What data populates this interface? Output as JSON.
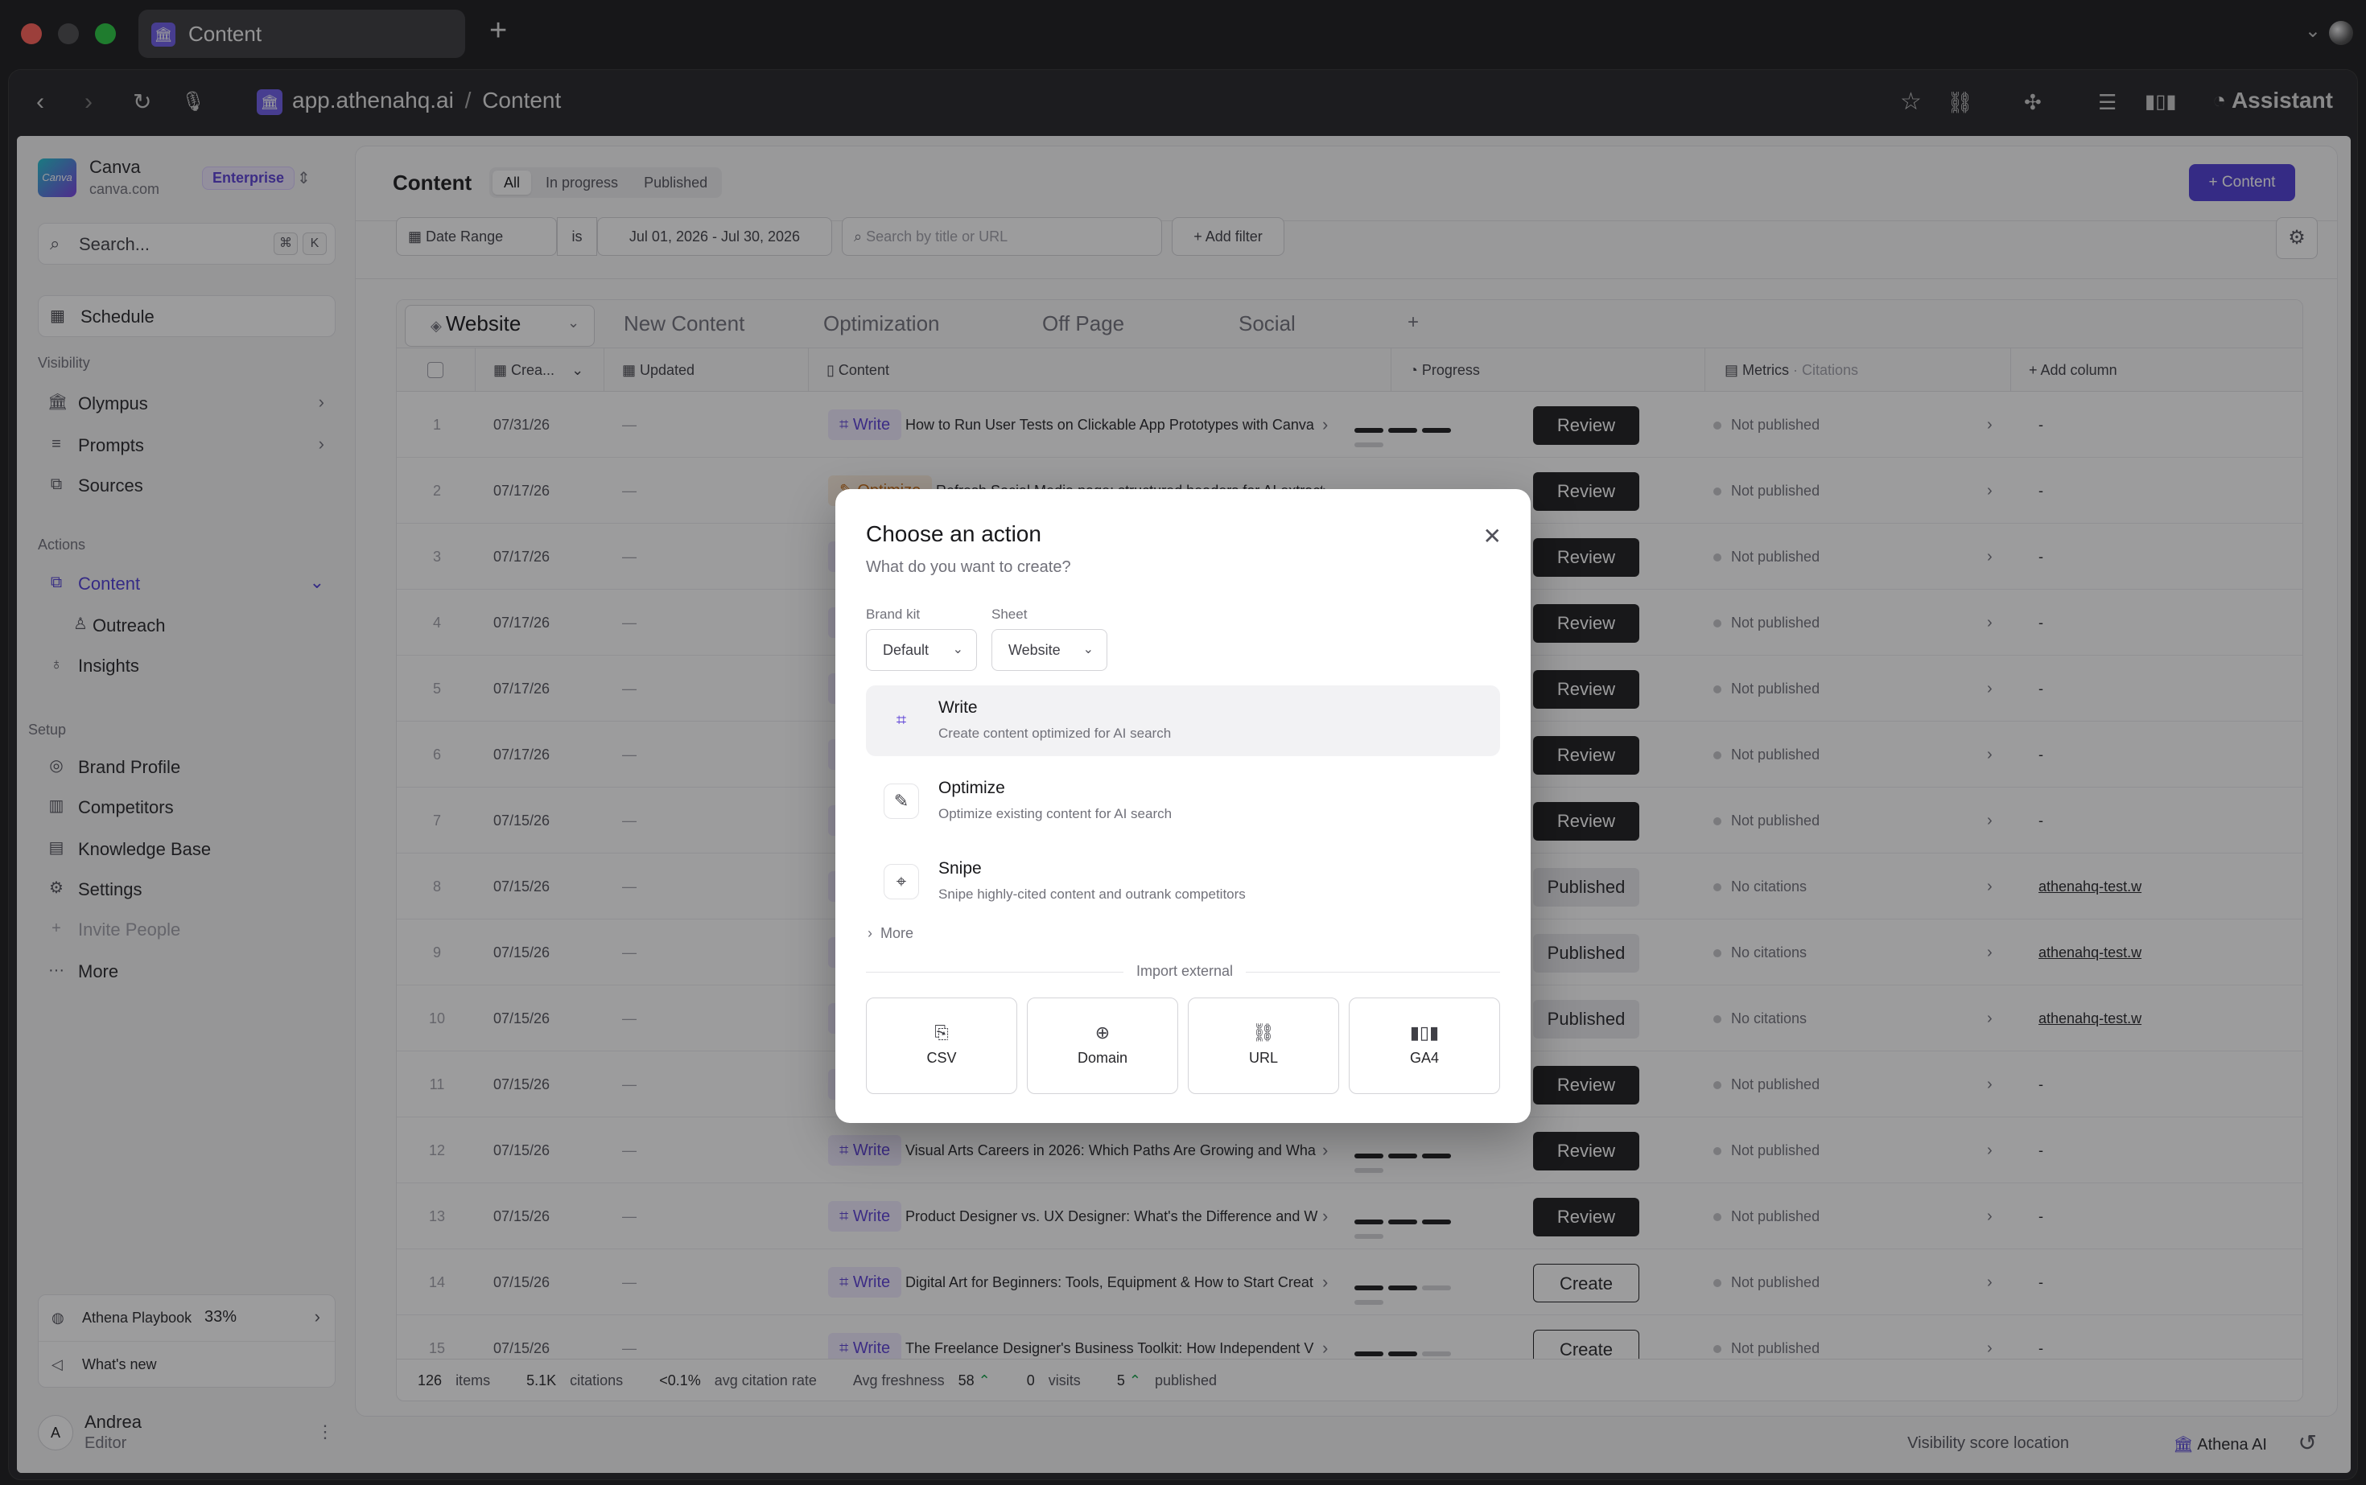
{
  "browser": {
    "tab_title": "Content",
    "url_host": "app.athenahq.ai",
    "url_sep": "/",
    "url_page": "Content",
    "assistant_label": "Assistant"
  },
  "sidebar": {
    "org_name": "Canva",
    "org_domain": "canva.com",
    "logo_text": "Canva",
    "plan_badge": "Enterprise",
    "search_label": "Search...",
    "search_kbd_1": "⌘",
    "search_kbd_2": "K",
    "schedule_label": "Schedule",
    "visibility_heading": "Visibility",
    "visibility_items": [
      {
        "label": "Olympus"
      },
      {
        "label": "Prompts"
      },
      {
        "label": "Sources"
      }
    ],
    "actions_heading": "Actions",
    "actions_items": [
      {
        "label": "Content"
      },
      {
        "label": "Outreach"
      },
      {
        "label": "Insights"
      }
    ],
    "setup_heading": "Setup",
    "setup_items": [
      {
        "label": "Brand Profile"
      },
      {
        "label": "Competitors"
      },
      {
        "label": "Knowledge Base"
      },
      {
        "label": "Settings"
      },
      {
        "label": "Invite People"
      },
      {
        "label": "More"
      }
    ],
    "playbook_label": "Athena Playbook",
    "playbook_percent": "33%",
    "whats_new_label": "What's new",
    "user_initial": "A",
    "user_name": "Andrea",
    "user_role": "Editor"
  },
  "header": {
    "title": "Content",
    "filter_tabs": [
      "All",
      "In progress",
      "Published"
    ],
    "new_button": "+ Content",
    "date_range_label": "Date Range",
    "date_op": "is",
    "date_value": "Jul 01, 2026 - Jul 30, 2026",
    "search_placeholder": "Search by title or URL",
    "add_filter": "+ Add filter"
  },
  "sheets": [
    "Website",
    "New Content",
    "Optimization",
    "Off Page",
    "Social"
  ],
  "columns": {
    "created": "Crea...",
    "updated": "Updated",
    "content": "Content",
    "progress": "Progress",
    "metrics": "Metrics",
    "metrics_sub": "· Citations",
    "add_column": "Add column"
  },
  "rows": [
    {
      "n": "1",
      "date": "07/31/26",
      "updated": "—",
      "tag": "Write",
      "title": "How to Run User Tests on Clickable App Prototypes with Canva",
      "progress": 3,
      "action": "Review",
      "status": "Not published",
      "link": "-"
    },
    {
      "n": "2",
      "date": "07/17/26",
      "updated": "—",
      "tag": "Optimize",
      "title": "Refresh Social Media page: structured headers for AI extractab",
      "progress": 3,
      "action": "Review",
      "status": "Not published",
      "link": "-"
    },
    {
      "n": "3",
      "date": "07/17/26",
      "updated": "—",
      "tag": "Write",
      "title": "",
      "progress": 3,
      "action": "Review",
      "status": "Not published",
      "link": "-"
    },
    {
      "n": "4",
      "date": "07/17/26",
      "updated": "—",
      "tag": "Write",
      "title": "",
      "progress": 3,
      "action": "Review",
      "status": "Not published",
      "link": "-"
    },
    {
      "n": "5",
      "date": "07/17/26",
      "updated": "—",
      "tag": "Write",
      "title": "",
      "progress": 3,
      "action": "Review",
      "status": "Not published",
      "link": "-"
    },
    {
      "n": "6",
      "date": "07/17/26",
      "updated": "—",
      "tag": "Write",
      "title": "",
      "progress": 3,
      "action": "Review",
      "status": "Not published",
      "link": "-"
    },
    {
      "n": "7",
      "date": "07/15/26",
      "updated": "—",
      "tag": "Write",
      "title": "",
      "progress": 3,
      "action": "Review",
      "status": "Not published",
      "link": "-"
    },
    {
      "n": "8",
      "date": "07/15/26",
      "updated": "—",
      "tag": "Write",
      "title": "",
      "progress": 4,
      "action": "Published",
      "status": "No citations",
      "link": "athenahq-test.w"
    },
    {
      "n": "9",
      "date": "07/15/26",
      "updated": "—",
      "tag": "Write",
      "title": "",
      "progress": 4,
      "action": "Published",
      "status": "No citations",
      "link": "athenahq-test.w"
    },
    {
      "n": "10",
      "date": "07/15/26",
      "updated": "—",
      "tag": "Write",
      "title": "",
      "progress": 4,
      "action": "Published",
      "status": "No citations",
      "link": "athenahq-test.w"
    },
    {
      "n": "11",
      "date": "07/15/26",
      "updated": "—",
      "tag": "Write",
      "title": "",
      "progress": 3,
      "action": "Review",
      "status": "Not published",
      "link": "-"
    },
    {
      "n": "12",
      "date": "07/15/26",
      "updated": "—",
      "tag": "Write",
      "title": "Visual Arts Careers in 2026: Which Paths Are Growing and Wha",
      "progress": 3,
      "action": "Review",
      "status": "Not published",
      "link": "-"
    },
    {
      "n": "13",
      "date": "07/15/26",
      "updated": "—",
      "tag": "Write",
      "title": "Product Designer vs. UX Designer: What's the Difference and W",
      "progress": 3,
      "action": "Review",
      "status": "Not published",
      "link": "-"
    },
    {
      "n": "14",
      "date": "07/15/26",
      "updated": "—",
      "tag": "Write",
      "title": "Digital Art for Beginners: Tools, Equipment & How to Start Creat",
      "progress": 2,
      "action": "Create",
      "status": "Not published",
      "link": "-"
    },
    {
      "n": "15",
      "date": "07/15/26",
      "updated": "—",
      "tag": "Write",
      "title": "The Freelance Designer's Business Toolkit: How Independent V",
      "progress": 2,
      "action": "Create",
      "status": "Not published",
      "link": "-"
    }
  ],
  "footer": {
    "items_count": "126",
    "items_label": "items",
    "citations_count": "5.1K",
    "citations_label": "citations",
    "rate": "<0.1%",
    "rate_label": "avg citation rate",
    "freshness_label": "Avg freshness",
    "freshness_value": "58",
    "visits_count": "0",
    "visits_label": "visits",
    "published_count": "5",
    "published_label": "published"
  },
  "statusline": {
    "visibility_location": "Visibility score location",
    "athena_ai": "Athena AI"
  },
  "modal": {
    "title": "Choose an action",
    "subtitle": "What do you want to create?",
    "brand_kit_label": "Brand kit",
    "brand_kit_value": "Default",
    "sheet_label": "Sheet",
    "sheet_value": "Website",
    "options": [
      {
        "title": "Write",
        "desc": "Create content optimized for AI search"
      },
      {
        "title": "Optimize",
        "desc": "Optimize existing content for AI search"
      },
      {
        "title": "Snipe",
        "desc": "Snipe highly-cited content and outrank competitors"
      }
    ],
    "more_label": "More",
    "import_label": "Import external",
    "imports": [
      {
        "label": "CSV"
      },
      {
        "label": "Domain"
      },
      {
        "label": "URL"
      },
      {
        "label": "GA4"
      }
    ]
  },
  "colors": {
    "accent": "#4f3dd6",
    "write_tag": "#5b3fd6",
    "optimize_tag": "#c76a10"
  }
}
